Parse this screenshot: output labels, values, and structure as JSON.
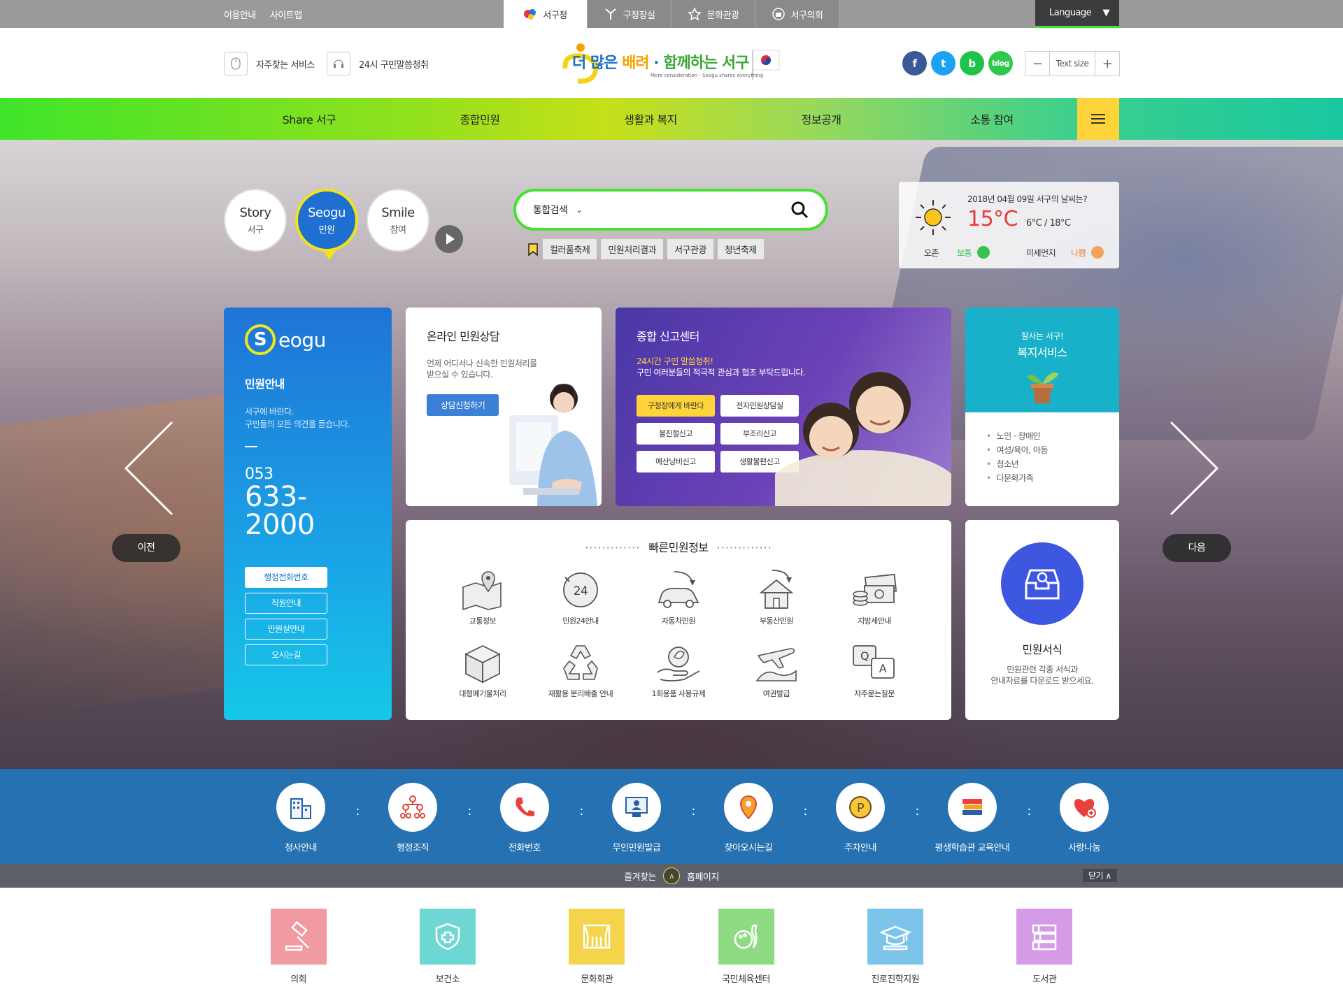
{
  "topbar": {
    "util": [
      "이용안내",
      "사이트맵"
    ],
    "sites": [
      {
        "label": "서구청",
        "icon": "seogu-logo-icon",
        "active": true
      },
      {
        "label": "구청장실",
        "icon": "person-icon",
        "active": false
      },
      {
        "label": "문화관광",
        "icon": "star-icon",
        "active": false
      },
      {
        "label": "서구의회",
        "icon": "council-icon",
        "active": false
      }
    ],
    "language": "Language"
  },
  "header": {
    "links": [
      {
        "label": "자주찾는 서비스",
        "icon": "mouse-icon"
      },
      {
        "label": "24시 구민말씀청취",
        "icon": "headset-icon"
      }
    ],
    "logo": {
      "main_a": "더 많은",
      "main_b": "배려",
      "main_c": "함께하는 서구",
      "sub": "More consideration - Seogu shares everything"
    },
    "sns": [
      {
        "label": "f",
        "icon": "facebook-icon",
        "color": "#3b5998"
      },
      {
        "label": "t",
        "icon": "twitter-icon",
        "color": "#1da1f2"
      },
      {
        "label": "b",
        "icon": "band-icon",
        "color": "#1fc24a"
      },
      {
        "label": "blog",
        "icon": "blog-icon",
        "color": "#2dc84d"
      }
    ],
    "textsize": {
      "minus": "−",
      "label": "Text size",
      "plus": "+"
    }
  },
  "gnb": [
    "Share 서구",
    "종합민원",
    "생활과 복지",
    "정보공개",
    "소통 참여"
  ],
  "hero": {
    "tabs": [
      {
        "title": "Story",
        "sub": "서구"
      },
      {
        "title": "Seogu",
        "sub": "민원"
      },
      {
        "title": "Smile",
        "sub": "참여"
      }
    ],
    "search": {
      "select": "통합검색",
      "placeholder": ""
    },
    "keywords": [
      "컬러풀축제",
      "민원처리결과",
      "서구관광",
      "청년축제"
    ],
    "weather": {
      "date": "2018년 04월 09일 서구의 날씨는?",
      "temp": "15°C",
      "range": "6°C / 18°C",
      "ozone_label": "오존",
      "ozone_value": "보통",
      "dust_label": "미세먼지",
      "dust_value": "나쁨"
    },
    "civil": {
      "logo_letter": "S",
      "logo_rest": "eogu",
      "title": "민원안내",
      "desc1": "서구에 바란다.",
      "desc2": "구민들의 모든 의견을 듣습니다.",
      "tel_area": "053",
      "tel_num": "633-2000",
      "buttons": [
        "행정전화번호",
        "직원안내",
        "민원실안내",
        "오시는길"
      ]
    },
    "consult": {
      "title": "온라인 민원상담",
      "desc": "언제 어디서나 신속한 민원처리를 받으실 수 있습니다.",
      "button": "상담신청하기"
    },
    "report": {
      "title": "종합 신고센터",
      "highlight": "24시간 구민 말씀청취!",
      "desc": "구민 여러분들의 적극적 관심과 협조 부탁드립니다.",
      "buttons": [
        "구청장에게 바란다",
        "전자민원상담실",
        "불친절신고",
        "부조리신고",
        "예산낭비신고",
        "생활불편신고"
      ]
    },
    "welfare": {
      "title_a": "잘사는 서구!",
      "title_b": "복지서비스",
      "items": [
        "노인 · 장애인",
        "여성/육아, 아동",
        "청소년",
        "다문화가족"
      ]
    },
    "quick": {
      "title": "빠른민원정보",
      "dots": "·············",
      "items": [
        {
          "label": "교통정보",
          "icon": "map-pin-icon"
        },
        {
          "label": "민원24안내",
          "icon": "clock-24-icon"
        },
        {
          "label": "자동차민원",
          "icon": "car-icon"
        },
        {
          "label": "부동산민원",
          "icon": "house-icon"
        },
        {
          "label": "지방세안내",
          "icon": "money-icon"
        },
        {
          "label": "대형폐기물처리",
          "icon": "box-icon"
        },
        {
          "label": "재활용 분리배출 안내",
          "icon": "recycle-icon"
        },
        {
          "label": "1회용품 사용규제",
          "icon": "hand-leaf-icon"
        },
        {
          "label": "여권발급",
          "icon": "plane-icon"
        },
        {
          "label": "자주묻는질문",
          "icon": "qa-icon"
        }
      ]
    },
    "forms": {
      "title": "민원서식",
      "desc1": "민원관련 각종 서식과",
      "desc2": "안내자료를 다운로드 받으세요."
    },
    "prev": "이전",
    "next": "다음"
  },
  "services": [
    {
      "label": "청사안내",
      "icon": "building-icon"
    },
    {
      "label": "행정조직",
      "icon": "org-chart-icon"
    },
    {
      "label": "전화번호",
      "icon": "phone-icon"
    },
    {
      "label": "무인민원발급",
      "icon": "kiosk-icon"
    },
    {
      "label": "찾아오시는길",
      "icon": "location-icon"
    },
    {
      "label": "주차안내",
      "icon": "parking-icon"
    },
    {
      "label": "평생학습관 교육안내",
      "icon": "books-icon"
    },
    {
      "label": "사랑나눔",
      "icon": "heart-icon"
    }
  ],
  "favbar": {
    "left": "즐겨찾는",
    "right": "홈페이지",
    "close": "닫기 ∧"
  },
  "homepages": [
    {
      "label": "의회",
      "icon": "gavel-icon",
      "color": "#f09aa1"
    },
    {
      "label": "보건소",
      "icon": "shield-cross-icon",
      "color": "#6fd7d3"
    },
    {
      "label": "문화회관",
      "icon": "theater-icon",
      "color": "#f3d44a"
    },
    {
      "label": "국민체육센터",
      "icon": "bowling-icon",
      "color": "#8fdb83"
    },
    {
      "label": "진로진학지원",
      "icon": "graduation-icon",
      "color": "#7cc4ea"
    },
    {
      "label": "도서관",
      "icon": "library-icon",
      "color": "#d59be6"
    }
  ]
}
